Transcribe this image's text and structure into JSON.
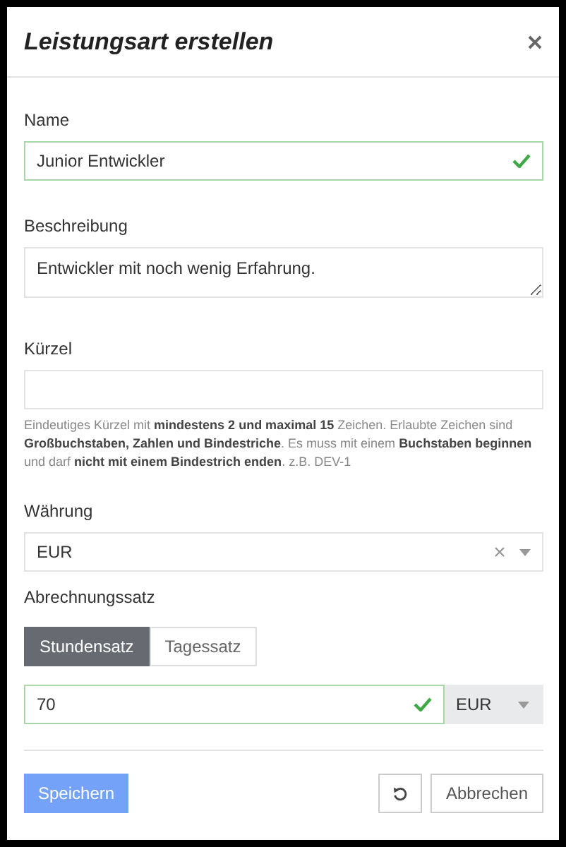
{
  "dialog": {
    "title": "Leistungsart erstellen"
  },
  "name": {
    "label": "Name",
    "value": "Junior Entwickler",
    "valid": true
  },
  "description": {
    "label": "Beschreibung",
    "value": "Entwickler mit noch wenig Erfahrung."
  },
  "abbreviation": {
    "label": "Kürzel",
    "help": "Eindeutiges Kürzel mit **mindestens 2 und maximal 15** Zeichen. Erlaubte Zeichen sind **Großbuchstaben, Zahlen und Bindestriche**. Es muss mit einem **Buchstaben beginnen** und darf **nicht mit einem Bindestrich enden**. z.B. DEV-1"
  },
  "currency": {
    "label": "Währung",
    "value": "EUR"
  },
  "rate": {
    "label": "Abrechnungssatz",
    "options": [
      {
        "label": "Stundensatz",
        "selected": true
      },
      {
        "label": "Tagessatz",
        "selected": false
      }
    ],
    "amount": {
      "value": "70",
      "valid": true
    },
    "unit": "EUR"
  },
  "buttons": {
    "save": {
      "label": "Speichern",
      "disabled": true
    },
    "cancel": {
      "label": "Abbrechen"
    }
  }
}
